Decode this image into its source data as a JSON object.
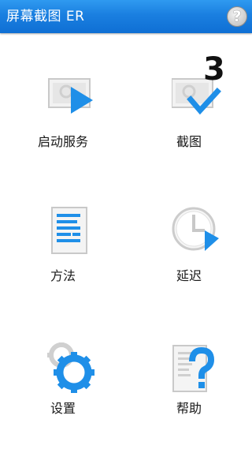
{
  "app": {
    "title": "屏幕截图 ER",
    "help_symbol": "?"
  },
  "menu": {
    "items": [
      {
        "label": "启动服务",
        "icon": "play-screen-icon"
      },
      {
        "label": "截图",
        "icon": "capture-check-icon"
      },
      {
        "label": "方法",
        "icon": "document-icon"
      },
      {
        "label": "延迟",
        "icon": "clock-icon"
      },
      {
        "label": "设置",
        "icon": "gear-icon"
      },
      {
        "label": "帮助",
        "icon": "help-document-icon"
      }
    ]
  },
  "capture_count": "3",
  "colors": {
    "accent_blue": "#1a7fe0",
    "icon_blue": "#1f8fe8",
    "icon_gray": "#d8d8d8"
  }
}
